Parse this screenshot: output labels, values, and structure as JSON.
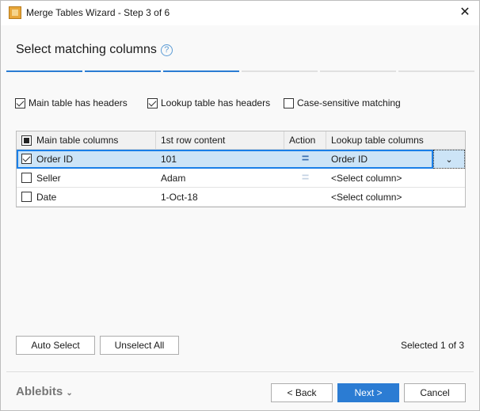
{
  "window": {
    "title": "Merge Tables Wizard - Step 3 of 6",
    "close": "✕"
  },
  "heading": "Select matching columns",
  "help": "?",
  "steps": {
    "total": 6,
    "current": 3
  },
  "options": [
    {
      "label": "Main table has headers",
      "checked": true
    },
    {
      "label": "Lookup table has headers",
      "checked": true
    },
    {
      "label": "Case-sensitive matching",
      "checked": false
    }
  ],
  "table": {
    "headers": [
      "Main table columns",
      "1st row content",
      "Action",
      "Lookup table columns"
    ],
    "rows": [
      {
        "checked": true,
        "main": "Order ID",
        "content": "101",
        "action": "=",
        "lookup": "Order ID"
      },
      {
        "checked": false,
        "main": "Seller",
        "content": "Adam",
        "action": "=",
        "lookup": "<Select column>"
      },
      {
        "checked": false,
        "main": "Date",
        "content": "1-Oct-18",
        "action": "",
        "lookup": "<Select column>"
      }
    ]
  },
  "buttons": {
    "auto_select": "Auto Select",
    "unselect_all": "Unselect All",
    "back": "< Back",
    "next": "Next >",
    "cancel": "Cancel"
  },
  "status": "Selected 1 of 3",
  "brand": "Ablebits",
  "colors": {
    "accent": "#2b7cd3",
    "selection": "#cce4f7"
  }
}
